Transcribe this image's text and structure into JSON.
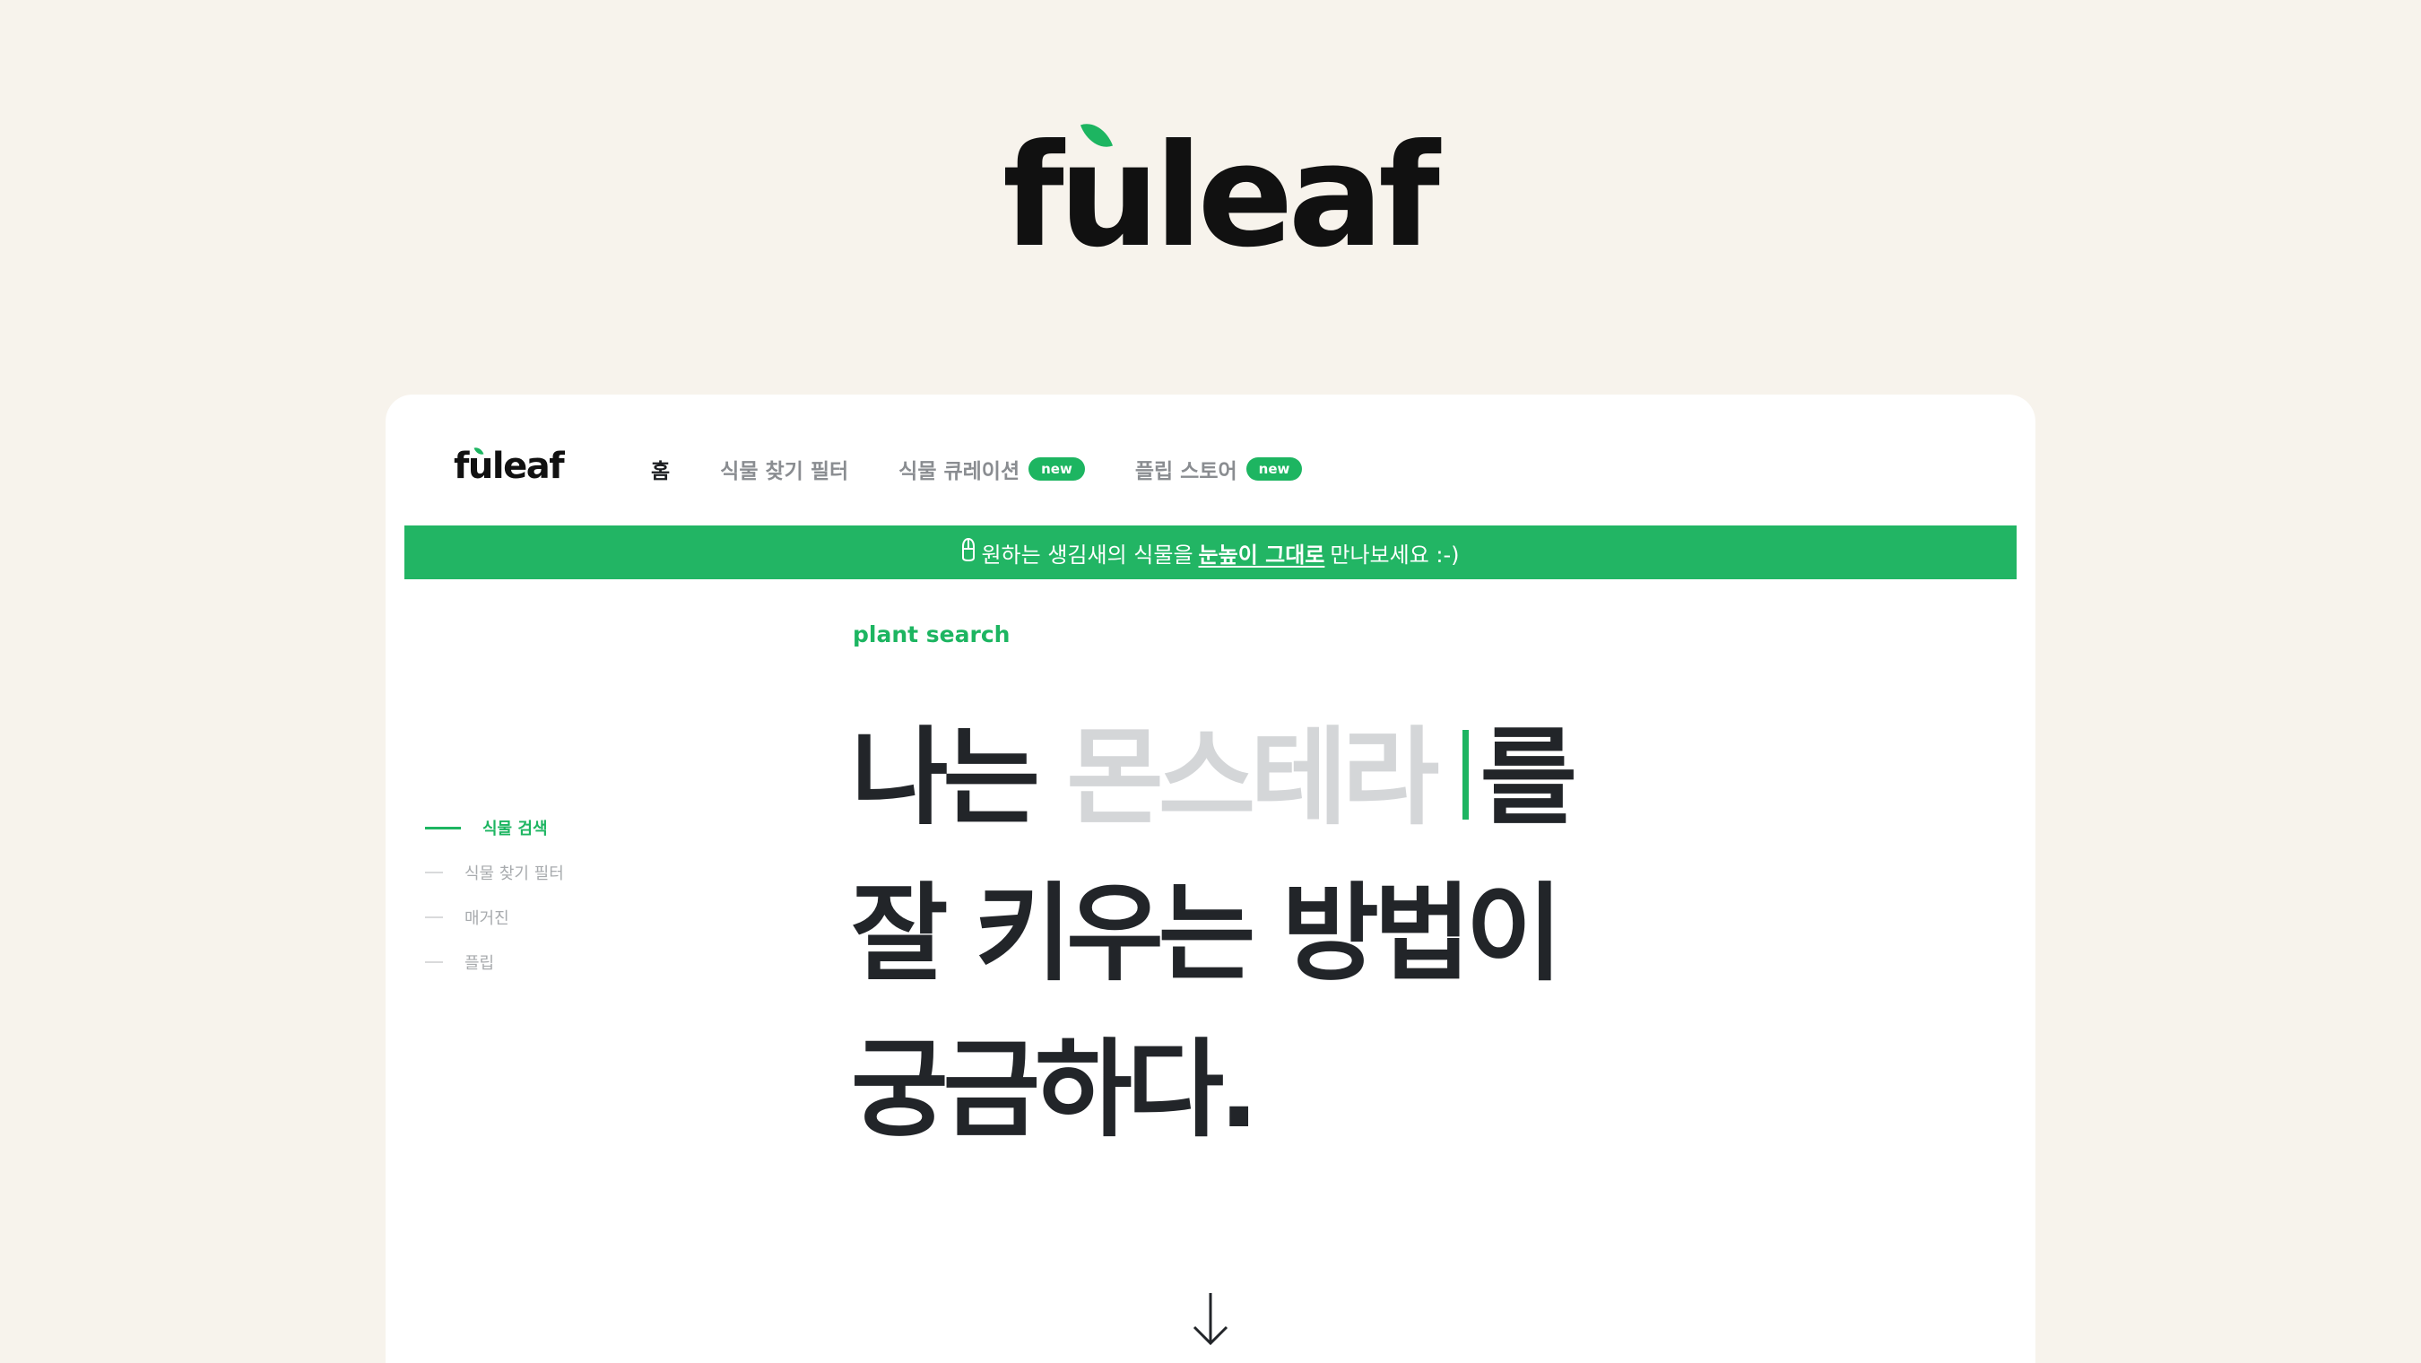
{
  "brand": {
    "logo_text": "fuleaf"
  },
  "nav": {
    "logo_text": "fuleaf",
    "items": [
      {
        "label": "홈",
        "active": true,
        "badge": ""
      },
      {
        "label": "식물 찾기 필터",
        "active": false,
        "badge": ""
      },
      {
        "label": "식물 큐레이션",
        "active": false,
        "badge": "new"
      },
      {
        "label": "플립 스토어",
        "active": false,
        "badge": "new"
      }
    ]
  },
  "banner": {
    "icon": "pin-icon",
    "text_before": "원하는 생김새의 식물을",
    "text_link": "눈높이 그대로",
    "text_after": "만나보세요 :-)"
  },
  "side_nav": {
    "items": [
      {
        "label": "식물 검색",
        "active": true
      },
      {
        "label": "식물 찾기 필터",
        "active": false
      },
      {
        "label": "매거진",
        "active": false
      },
      {
        "label": "플립",
        "active": false
      }
    ]
  },
  "hero": {
    "eyebrow": "plant search",
    "line1_prefix": "나는",
    "line1_typing": "몬스테라",
    "line1_suffix": "를",
    "line2": "잘 키우는 방법이",
    "line3": "궁금하다."
  },
  "colors": {
    "accent": "#1db561",
    "banner": "#22b564",
    "background": "#f7f3ec",
    "text": "#222529"
  }
}
